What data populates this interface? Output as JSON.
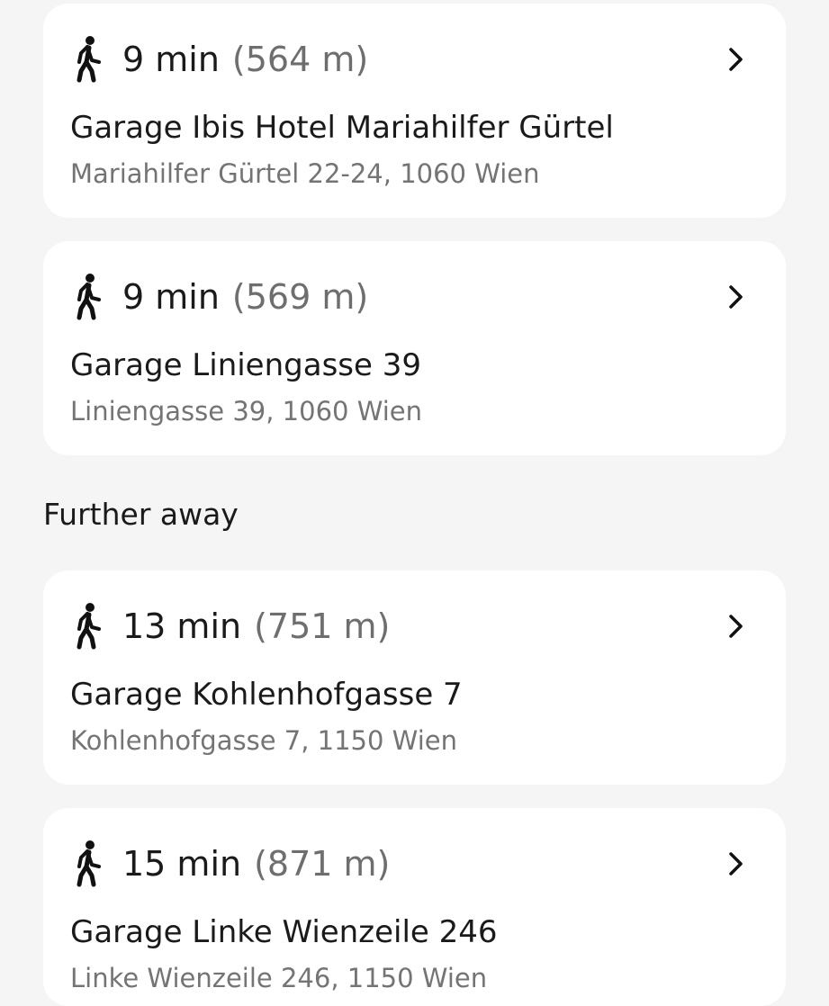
{
  "section_further_title": "Further away",
  "results": [
    {
      "duration": "9 min",
      "distance": "(564 m)",
      "name": "Garage Ibis Hotel Mariahilfer Gürtel",
      "address": "Mariahilfer Gürtel 22-24, 1060 Wien"
    },
    {
      "duration": "9 min",
      "distance": "(569 m)",
      "name": "Garage Liniengasse 39",
      "address": "Liniengasse 39, 1060 Wien"
    },
    {
      "duration": "13 min",
      "distance": "(751 m)",
      "name": "Garage Kohlenhofgasse 7",
      "address": "Kohlenhofgasse 7, 1150 Wien"
    },
    {
      "duration": "15 min",
      "distance": "(871 m)",
      "name": "Garage Linke Wienzeile 246",
      "address": "Linke Wienzeile 246, 1150 Wien"
    }
  ],
  "icons": {
    "walk": "pedestrian-walking-icon",
    "chevron": "chevron-right-icon"
  },
  "colors": {
    "background": "#f5f5f5",
    "card": "#ffffff",
    "primary_text": "#1a1a1a",
    "secondary_text": "#747474"
  }
}
